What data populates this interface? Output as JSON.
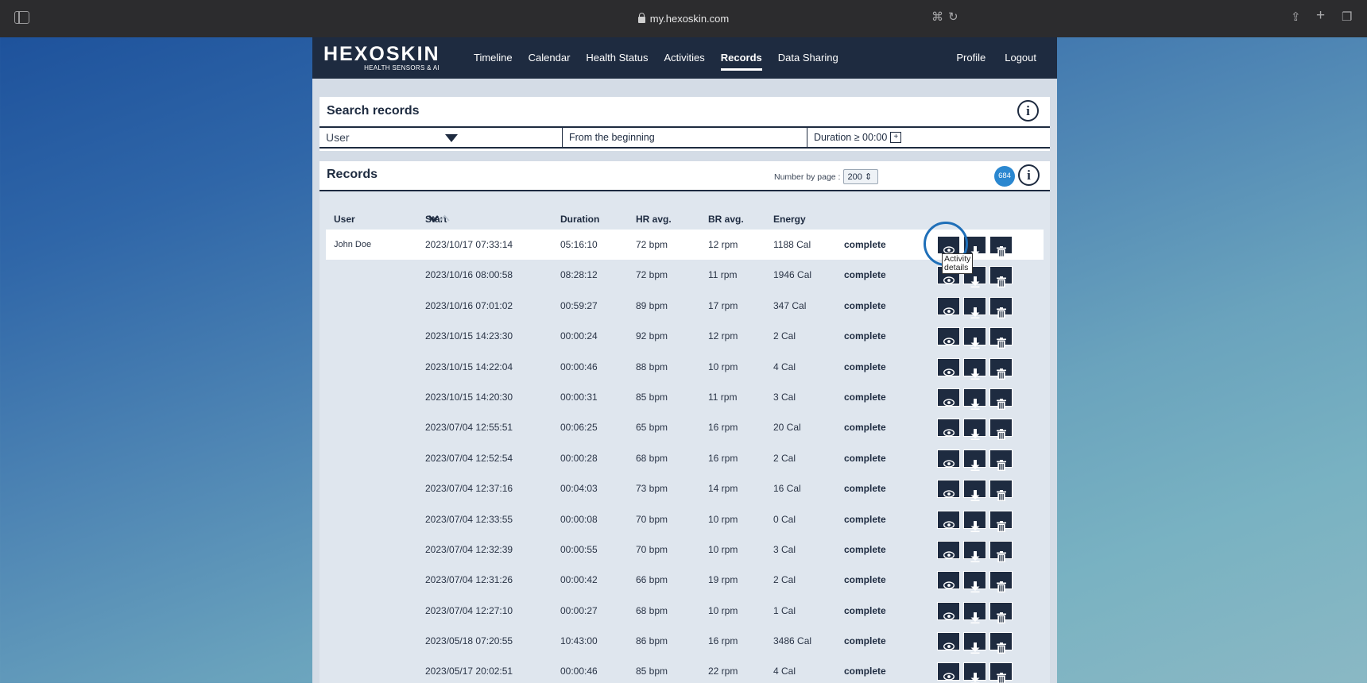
{
  "browser": {
    "url": "my.hexoskin.com"
  },
  "nav": {
    "brand": "HEXOSKIN",
    "tagline": "HEALTH SENSORS & AI",
    "items": [
      "Timeline",
      "Calendar",
      "Health Status",
      "Activities",
      "Records",
      "Data Sharing"
    ],
    "active": "Records",
    "right": [
      "Profile",
      "Logout"
    ]
  },
  "search": {
    "title": "Search records",
    "user_placeholder": "User",
    "from": "From the beginning",
    "duration": "Duration ≥ 00:00",
    "plus": "+"
  },
  "records": {
    "title": "Records",
    "per_page_label": "Number by page :",
    "per_page_value": "200",
    "count": "684",
    "columns": {
      "user": "User",
      "start": "Start",
      "duration": "Duration",
      "hr": "HR avg.",
      "br": "BR avg.",
      "energy": "Energy"
    },
    "rows": [
      {
        "user": "John Doe",
        "start": "2023/10/17 07:33:14",
        "duration": "05:16:10",
        "hr": "72 bpm",
        "br": "12 rpm",
        "energy": "1188 Cal",
        "status": "complete"
      },
      {
        "user": "",
        "start": "2023/10/16 08:00:58",
        "duration": "08:28:12",
        "hr": "72 bpm",
        "br": "11 rpm",
        "energy": "1946 Cal",
        "status": "complete"
      },
      {
        "user": "",
        "start": "2023/10/16 07:01:02",
        "duration": "00:59:27",
        "hr": "89 bpm",
        "br": "17 rpm",
        "energy": "347 Cal",
        "status": "complete"
      },
      {
        "user": "",
        "start": "2023/10/15 14:23:30",
        "duration": "00:00:24",
        "hr": "92 bpm",
        "br": "12 rpm",
        "energy": "2 Cal",
        "status": "complete"
      },
      {
        "user": "",
        "start": "2023/10/15 14:22:04",
        "duration": "00:00:46",
        "hr": "88 bpm",
        "br": "10 rpm",
        "energy": "4 Cal",
        "status": "complete"
      },
      {
        "user": "",
        "start": "2023/10/15 14:20:30",
        "duration": "00:00:31",
        "hr": "85 bpm",
        "br": "11 rpm",
        "energy": "3 Cal",
        "status": "complete"
      },
      {
        "user": "",
        "start": "2023/07/04 12:55:51",
        "duration": "00:06:25",
        "hr": "65 bpm",
        "br": "16 rpm",
        "energy": "20 Cal",
        "status": "complete"
      },
      {
        "user": "",
        "start": "2023/07/04 12:52:54",
        "duration": "00:00:28",
        "hr": "68 bpm",
        "br": "16 rpm",
        "energy": "2 Cal",
        "status": "complete"
      },
      {
        "user": "",
        "start": "2023/07/04 12:37:16",
        "duration": "00:04:03",
        "hr": "73 bpm",
        "br": "14 rpm",
        "energy": "16 Cal",
        "status": "complete"
      },
      {
        "user": "",
        "start": "2023/07/04 12:33:55",
        "duration": "00:00:08",
        "hr": "70 bpm",
        "br": "10 rpm",
        "energy": "0 Cal",
        "status": "complete"
      },
      {
        "user": "",
        "start": "2023/07/04 12:32:39",
        "duration": "00:00:55",
        "hr": "70 bpm",
        "br": "10 rpm",
        "energy": "3 Cal",
        "status": "complete"
      },
      {
        "user": "",
        "start": "2023/07/04 12:31:26",
        "duration": "00:00:42",
        "hr": "66 bpm",
        "br": "19 rpm",
        "energy": "2 Cal",
        "status": "complete"
      },
      {
        "user": "",
        "start": "2023/07/04 12:27:10",
        "duration": "00:00:27",
        "hr": "68 bpm",
        "br": "10 rpm",
        "energy": "1 Cal",
        "status": "complete"
      },
      {
        "user": "",
        "start": "2023/05/18 07:20:55",
        "duration": "10:43:00",
        "hr": "86 bpm",
        "br": "16 rpm",
        "energy": "3486 Cal",
        "status": "complete"
      },
      {
        "user": "",
        "start": "2023/05/17 20:02:51",
        "duration": "00:00:46",
        "hr": "85 bpm",
        "br": "22 rpm",
        "energy": "4 Cal",
        "status": "complete"
      }
    ],
    "tooltip": "Activity details",
    "tooltip_line1": "Activity",
    "tooltip_line2": "details"
  },
  "icons": {
    "view": "eye-icon",
    "download": "download-icon",
    "delete": "trash-icon",
    "info": "info-icon",
    "sort": "chevron-down-icon"
  },
  "colors": {
    "navy": "#1e2b40",
    "badge": "#2a87d0",
    "focus": "#1f6fb8"
  }
}
